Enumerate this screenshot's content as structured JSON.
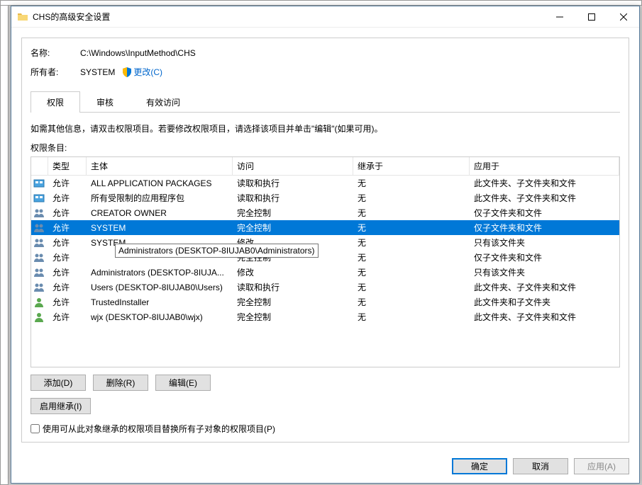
{
  "window": {
    "title": "CHS的高级安全设置"
  },
  "labels": {
    "name_label": "名称:",
    "name_value": "C:\\Windows\\InputMethod\\CHS",
    "owner_label": "所有者:",
    "owner_value": "SYSTEM",
    "change_link": "更改(C)"
  },
  "tabs": {
    "permissions": "权限",
    "audit": "审核",
    "effective": "有效访问"
  },
  "info_text": "如需其他信息，请双击权限项目。若要修改权限项目，请选择该项目并单击\"编辑\"(如果可用)。",
  "entries_label": "权限条目:",
  "columns": {
    "type": "类型",
    "principal": "主体",
    "access": "访问",
    "inherited": "继承于",
    "applies": "应用于"
  },
  "rows": [
    {
      "icon": "pkg",
      "type": "允许",
      "principal": "ALL APPLICATION PACKAGES",
      "access": "读取和执行",
      "inherited": "无",
      "applies": "此文件夹、子文件夹和文件"
    },
    {
      "icon": "pkg",
      "type": "允许",
      "principal": "所有受限制的应用程序包",
      "access": "读取和执行",
      "inherited": "无",
      "applies": "此文件夹、子文件夹和文件"
    },
    {
      "icon": "grp",
      "type": "允许",
      "principal": "CREATOR OWNER",
      "access": "完全控制",
      "inherited": "无",
      "applies": "仅子文件夹和文件"
    },
    {
      "icon": "grp",
      "type": "允许",
      "principal": "SYSTEM",
      "access": "完全控制",
      "inherited": "无",
      "applies": "仅子文件夹和文件",
      "selected": true
    },
    {
      "icon": "grp",
      "type": "允许",
      "principal": "SYSTEM",
      "access": "修改",
      "inherited": "无",
      "applies": "只有该文件夹"
    },
    {
      "icon": "grp",
      "type": "允许",
      "principal": "Administrators (DESKTOP-8IUJAB0\\Administrators)",
      "access": "完全控制",
      "inherited": "无",
      "applies": "仅子文件夹和文件",
      "tooltip": true
    },
    {
      "icon": "grp",
      "type": "允许",
      "principal": "Administrators (DESKTOP-8IUJA...",
      "access": "修改",
      "inherited": "无",
      "applies": "只有该文件夹"
    },
    {
      "icon": "grp",
      "type": "允许",
      "principal": "Users (DESKTOP-8IUJAB0\\Users)",
      "access": "读取和执行",
      "inherited": "无",
      "applies": "此文件夹、子文件夹和文件"
    },
    {
      "icon": "usr",
      "type": "允许",
      "principal": "TrustedInstaller",
      "access": "完全控制",
      "inherited": "无",
      "applies": "此文件夹和子文件夹"
    },
    {
      "icon": "usr",
      "type": "允许",
      "principal": "wjx (DESKTOP-8IUJAB0\\wjx)",
      "access": "完全控制",
      "inherited": "无",
      "applies": "此文件夹、子文件夹和文件"
    }
  ],
  "tooltip_text": "Administrators (DESKTOP-8IUJAB0\\Administrators)",
  "buttons": {
    "add": "添加(D)",
    "remove": "删除(R)",
    "edit": "编辑(E)",
    "enable_inherit": "启用继承(I)",
    "replace_cb": "使用可从此对象继承的权限项目替换所有子对象的权限项目(P)",
    "ok": "确定",
    "cancel": "取消",
    "apply": "应用(A)"
  }
}
